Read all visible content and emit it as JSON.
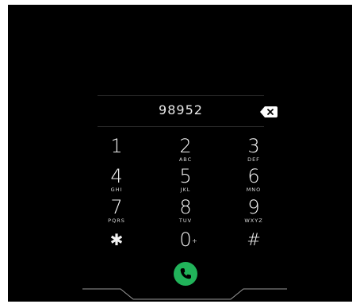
{
  "dialer": {
    "number": "98952",
    "keys": [
      {
        "digit": "1",
        "letters": ""
      },
      {
        "digit": "2",
        "letters": "ABC"
      },
      {
        "digit": "3",
        "letters": "DEF"
      },
      {
        "digit": "4",
        "letters": "GHI"
      },
      {
        "digit": "5",
        "letters": "JKL"
      },
      {
        "digit": "6",
        "letters": "MNO"
      },
      {
        "digit": "7",
        "letters": "PQRS"
      },
      {
        "digit": "8",
        "letters": "TUV"
      },
      {
        "digit": "9",
        "letters": "WXYZ"
      },
      {
        "digit": "✱",
        "letters": ""
      },
      {
        "digit": "0",
        "letters": "",
        "secondary": "+"
      },
      {
        "digit": "#",
        "letters": ""
      }
    ]
  },
  "icons": {
    "backspace": "backspace-icon",
    "call": "phone-icon"
  },
  "colors": {
    "background": "#000000",
    "text": "#f2f2f2",
    "call_button": "#21b35a",
    "frame": "#9a9a9a"
  }
}
